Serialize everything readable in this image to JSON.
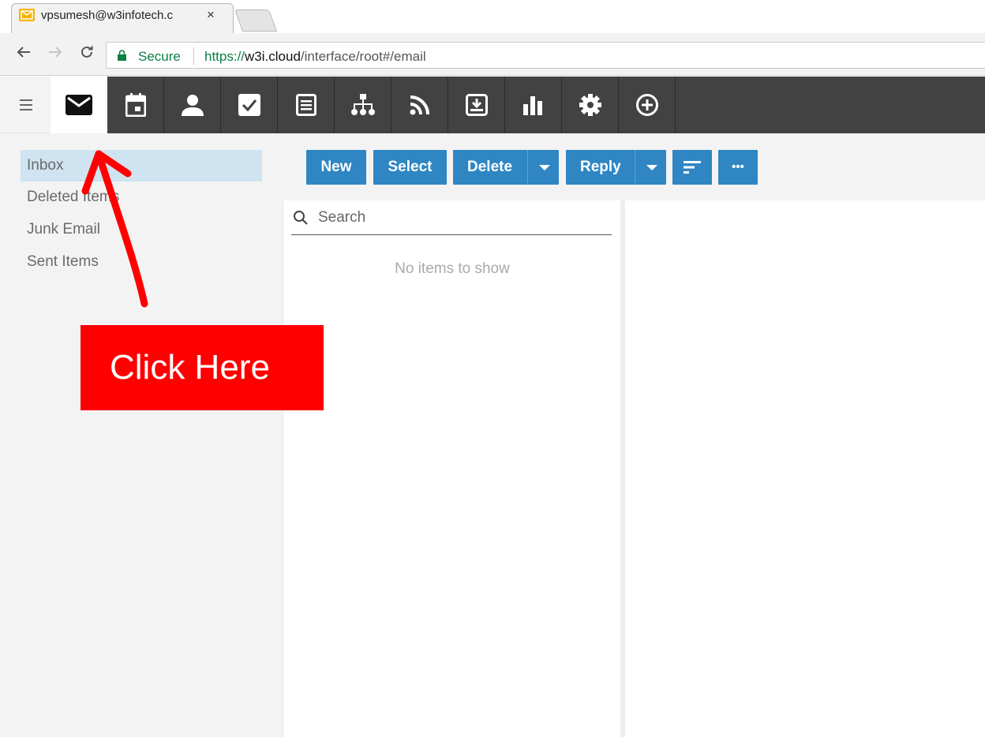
{
  "browser": {
    "tab_title": "vpsumesh@w3infotech.c",
    "tab_close": "×",
    "secure_label": "Secure",
    "url_scheme": "https://",
    "url_host": "w3i.cloud",
    "url_path": "/interface/root#/email"
  },
  "app_nav": {
    "items": [
      {
        "icon": "envelope-icon",
        "active": true
      },
      {
        "icon": "calendar-icon"
      },
      {
        "icon": "contacts-icon"
      },
      {
        "icon": "tasks-icon"
      },
      {
        "icon": "notes-icon"
      },
      {
        "icon": "org-chart-icon"
      },
      {
        "icon": "rss-icon"
      },
      {
        "icon": "archive-icon"
      },
      {
        "icon": "reports-icon"
      },
      {
        "icon": "settings-icon"
      },
      {
        "icon": "add-icon"
      }
    ],
    "bar_color": "#424242"
  },
  "folders": {
    "items": [
      {
        "label": "Inbox",
        "selected": true
      },
      {
        "label": "Deleted Items"
      },
      {
        "label": "Junk Email"
      },
      {
        "label": "Sent Items"
      }
    ]
  },
  "toolbar": {
    "new_label": "New",
    "select_label": "Select",
    "delete_label": "Delete",
    "reply_label": "Reply",
    "more_label": "•••",
    "button_color": "#2f86c3"
  },
  "message_list": {
    "search_placeholder": "Search",
    "empty_text": "No items to show"
  },
  "annotation": {
    "callout_text": "Click Here",
    "callout_color": "#fe0000"
  }
}
